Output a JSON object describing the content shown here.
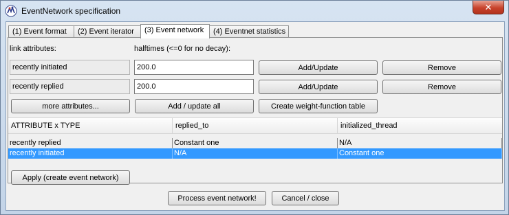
{
  "window": {
    "title": "EventNetwork specification",
    "close_glyph": "✕",
    "icon": "app-logo-icon"
  },
  "tabs": [
    {
      "label": "(1) Event format",
      "active": false
    },
    {
      "label": "(2) Event iterator",
      "active": false
    },
    {
      "label": "(3) Event network",
      "active": true
    },
    {
      "label": "(4) Eventnet statistics",
      "active": false
    }
  ],
  "section": {
    "link_attributes_label": "link attributes:",
    "halftimes_label": "halftimes (<=0 for no decay):"
  },
  "attributes": [
    {
      "name": "recently initiated",
      "halftime": "200.0",
      "add_label": "Add/Update",
      "remove_label": "Remove"
    },
    {
      "name": "recently replied",
      "halftime": "200.0",
      "add_label": "Add/Update",
      "remove_label": "Remove"
    }
  ],
  "actions": {
    "more_attributes": "more attributes...",
    "add_update_all": "Add / update all",
    "create_weight_table": "Create weight-function table"
  },
  "table": {
    "headers": [
      "ATTRIBUTE x TYPE",
      "replied_to",
      "initialized_thread"
    ],
    "rows": [
      {
        "cells": [
          "recently replied",
          "Constant one",
          "N/A"
        ],
        "selected": false
      },
      {
        "cells": [
          "recently initiated",
          "N/A",
          "Constant one"
        ],
        "selected": true
      }
    ]
  },
  "apply_label": "Apply (create event network)",
  "footer": {
    "process_label": "Process event network!",
    "cancel_label": "Cancel / close"
  }
}
